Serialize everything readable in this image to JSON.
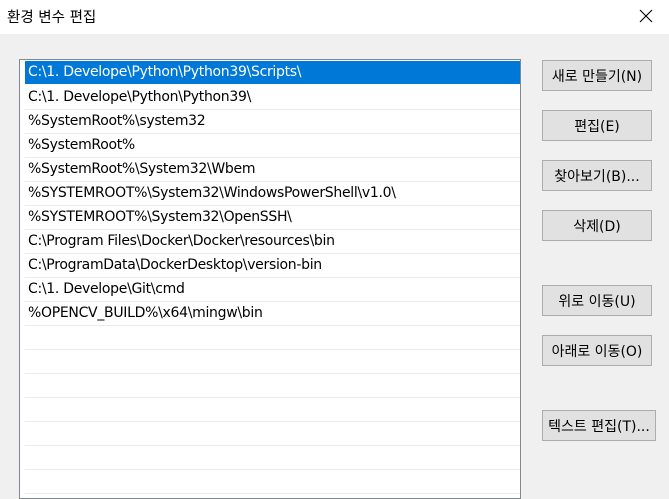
{
  "window": {
    "title": "환경 변수 편집"
  },
  "paths": [
    "C:\\1. Develope\\Python\\Python39\\Scripts\\",
    "C:\\1. Develope\\Python\\Python39\\",
    "%SystemRoot%\\system32",
    "%SystemRoot%",
    "%SystemRoot%\\System32\\Wbem",
    "%SYSTEMROOT%\\System32\\WindowsPowerShell\\v1.0\\",
    "%SYSTEMROOT%\\System32\\OpenSSH\\",
    "C:\\Program Files\\Docker\\Docker\\resources\\bin",
    "C:\\ProgramData\\DockerDesktop\\version-bin",
    "C:\\1. Develope\\Git\\cmd",
    "%OPENCV_BUILD%\\x64\\mingw\\bin"
  ],
  "selected_index": 0,
  "buttons": {
    "new": "새로 만들기(N)",
    "edit": "편집(E)",
    "browse": "찾아보기(B)...",
    "delete": "삭제(D)",
    "move_up": "위로 이동(U)",
    "move_down": "아래로 이동(O)",
    "edit_text": "텍스트 편집(T)..."
  },
  "colors": {
    "selection": "#0078d7",
    "background": "#f0f0f0"
  }
}
